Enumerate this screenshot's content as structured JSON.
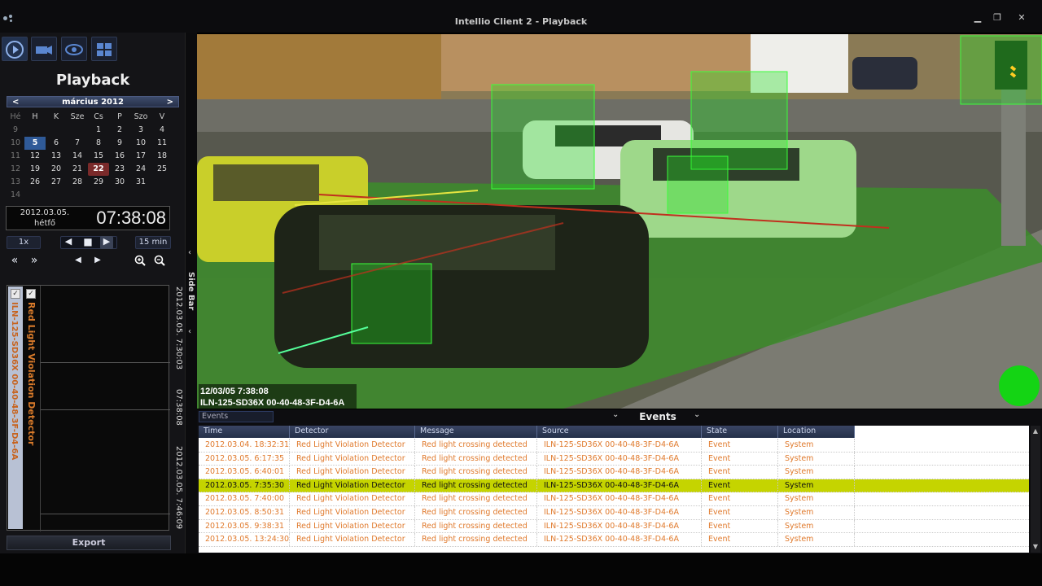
{
  "window": {
    "title": "Intellio Client 2 - Playback"
  },
  "left": {
    "title": "Playback",
    "calendar": {
      "month": "március 2012",
      "prev": "<",
      "next": ">",
      "header": [
        "Hé",
        "H",
        "K",
        "Sze",
        "Cs",
        "P",
        "Szo",
        "V"
      ],
      "rows": [
        [
          "9",
          "",
          "",
          "",
          "1",
          "2",
          "3",
          "4"
        ],
        [
          "10",
          "5",
          "6",
          "7",
          "8",
          "9",
          "10",
          "11"
        ],
        [
          "11",
          "12",
          "13",
          "14",
          "15",
          "16",
          "17",
          "18"
        ],
        [
          "12",
          "19",
          "20",
          "21",
          "22",
          "23",
          "24",
          "25"
        ],
        [
          "13",
          "26",
          "27",
          "28",
          "29",
          "30",
          "31",
          ""
        ],
        [
          "14",
          "",
          "",
          "",
          "",
          "",
          "",
          ""
        ]
      ]
    },
    "date": "2012.03.05.",
    "day": "hétfő",
    "time": "07:38:08",
    "speed": "1x",
    "interval": "15 min",
    "timeline": {
      "camera": "ILN-125-SD36X 00-40-48-3F-D4-6A",
      "detector": "Red Light Violation Detector",
      "start": "2012.03.05. 7:30:03",
      "current": "07:38:08",
      "end": "2012.03.05. 7:46:09"
    },
    "export": "Export"
  },
  "sidebar_label": "Side Bar",
  "video": {
    "overlay_time": "12/03/05 7:38:08",
    "overlay_camera": "ILN-125-SD36X 00-40-48-3F-D4-6A",
    "colors": {
      "zone": "#22e222",
      "violation_line": "#c0301e",
      "indicator": "#14d414"
    }
  },
  "events": {
    "tab": "Events",
    "title": "Events",
    "columns": [
      "Time",
      "Detector",
      "Message",
      "Source",
      "State",
      "Location"
    ],
    "rows": [
      [
        "2012.03.04. 18:32:31",
        "Red Light Violation Detector",
        "Red light crossing detected",
        "ILN-125-SD36X 00-40-48-3F-D4-6A",
        "Event",
        "System"
      ],
      [
        "2012.03.05. 6:17:35",
        "Red Light Violation Detector",
        "Red light crossing detected",
        "ILN-125-SD36X 00-40-48-3F-D4-6A",
        "Event",
        "System"
      ],
      [
        "2012.03.05. 6:40:01",
        "Red Light Violation Detector",
        "Red light crossing detected",
        "ILN-125-SD36X 00-40-48-3F-D4-6A",
        "Event",
        "System"
      ],
      [
        "2012.03.05. 7:35:30",
        "Red Light Violation Detector",
        "Red light crossing detected",
        "ILN-125-SD36X 00-40-48-3F-D4-6A",
        "Event",
        "System"
      ],
      [
        "2012.03.05. 7:40:00",
        "Red Light Violation Detector",
        "Red light crossing detected",
        "ILN-125-SD36X 00-40-48-3F-D4-6A",
        "Event",
        "System"
      ],
      [
        "2012.03.05. 8:50:31",
        "Red Light Violation Detector",
        "Red light crossing detected",
        "ILN-125-SD36X 00-40-48-3F-D4-6A",
        "Event",
        "System"
      ],
      [
        "2012.03.05. 9:38:31",
        "Red Light Violation Detector",
        "Red light crossing detected",
        "ILN-125-SD36X 00-40-48-3F-D4-6A",
        "Event",
        "System"
      ],
      [
        "2012.03.05. 13:24:30",
        "Red Light Violation Detector",
        "Red light crossing detected",
        "ILN-125-SD36X 00-40-48-3F-D4-6A",
        "Event",
        "System"
      ]
    ],
    "highlighted_row": 3,
    "colors": {
      "row_text": "#e07a2d",
      "highlight": "#c5d400"
    }
  }
}
